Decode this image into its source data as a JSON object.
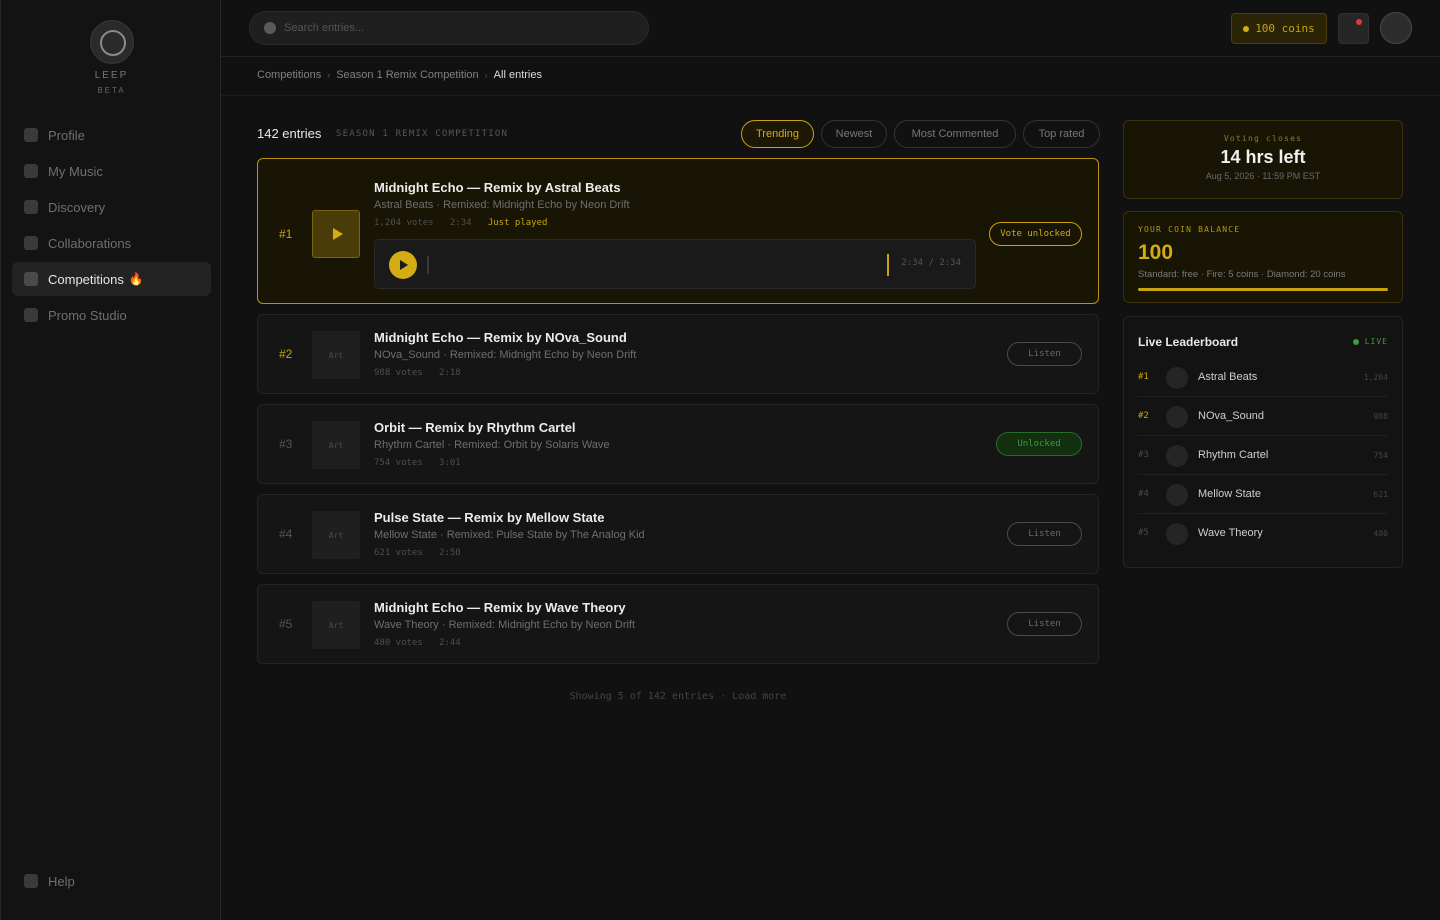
{
  "brand": {
    "name": "LEEP",
    "tag": "BETA"
  },
  "sidebar": {
    "items": [
      {
        "label": "Profile"
      },
      {
        "label": "My Music"
      },
      {
        "label": "Discovery"
      },
      {
        "label": "Collaborations"
      },
      {
        "label": "Competitions",
        "badge": "🔥"
      },
      {
        "label": "Promo Studio"
      }
    ],
    "help": "Help"
  },
  "topbar": {
    "search_placeholder": "Search entries...",
    "coins": "100 coins"
  },
  "breadcrumb": {
    "items": [
      "Competitions",
      "Season 1 Remix Competition",
      "All entries"
    ],
    "separator": "›"
  },
  "main": {
    "entries_count": "142 entries",
    "entries_sub": "SEASON 1 REMIX COMPETITION",
    "filters": [
      "Trending",
      "Newest",
      "Most Commented",
      "Top rated"
    ],
    "entries": [
      {
        "rank": "#1",
        "title": "Midnight Echo — Remix by Astral Beats",
        "subtitle": "Astral Beats · Remixed: Midnight Echo by Neon Drift",
        "votes": "1,204 votes",
        "duration": "2:34",
        "status": "Just played",
        "action": "Vote unlocked",
        "player_time": "2:34 / 2:34"
      },
      {
        "rank": "#2",
        "art": "Art",
        "title": "Midnight Echo — Remix by NOva_Sound",
        "subtitle": "NOva_Sound · Remixed: Midnight Echo by Neon Drift",
        "votes": "988 votes",
        "duration": "2:18",
        "action": "Listen"
      },
      {
        "rank": "#3",
        "art": "Art",
        "title": "Orbit — Remix by Rhythm Cartel",
        "subtitle": "Rhythm Cartel · Remixed: Orbit by Solaris Wave",
        "votes": "754 votes",
        "duration": "3:01",
        "action": "Unlocked"
      },
      {
        "rank": "#4",
        "art": "Art",
        "title": "Pulse State — Remix by Mellow State",
        "subtitle": "Mellow State · Remixed: Pulse State by The Analog Kid",
        "votes": "621 votes",
        "duration": "2:50",
        "action": "Listen"
      },
      {
        "rank": "#5",
        "art": "Art",
        "title": "Midnight Echo — Remix by Wave Theory",
        "subtitle": "Wave Theory · Remixed: Midnight Echo by Neon Drift",
        "votes": "480 votes",
        "duration": "2:44",
        "action": "Listen"
      }
    ],
    "footer": "Showing 5 of 142 entries · Load more"
  },
  "voting": {
    "label": "Voting closes",
    "time_left": "14 hrs left",
    "date": "Aug 5, 2026 · 11:59 PM EST"
  },
  "balance": {
    "label": "YOUR COIN BALANCE",
    "value": "100",
    "tiers": "Standard: free · Fire: 5 coins · Diamond: 20 coins"
  },
  "leaderboard": {
    "title": "Live Leaderboard",
    "live": "LIVE",
    "rows": [
      {
        "rank": "#1",
        "name": "Astral Beats",
        "votes": "1,204"
      },
      {
        "rank": "#2",
        "name": "NOva_Sound",
        "votes": "988"
      },
      {
        "rank": "#3",
        "name": "Rhythm Cartel",
        "votes": "754"
      },
      {
        "rank": "#4",
        "name": "Mellow State",
        "votes": "621"
      },
      {
        "rank": "#5",
        "name": "Wave Theory",
        "votes": "480"
      }
    ]
  },
  "colors": {
    "accent": "#d4ad14",
    "live": "#3e9a3e",
    "notif": "#e03a3a"
  }
}
